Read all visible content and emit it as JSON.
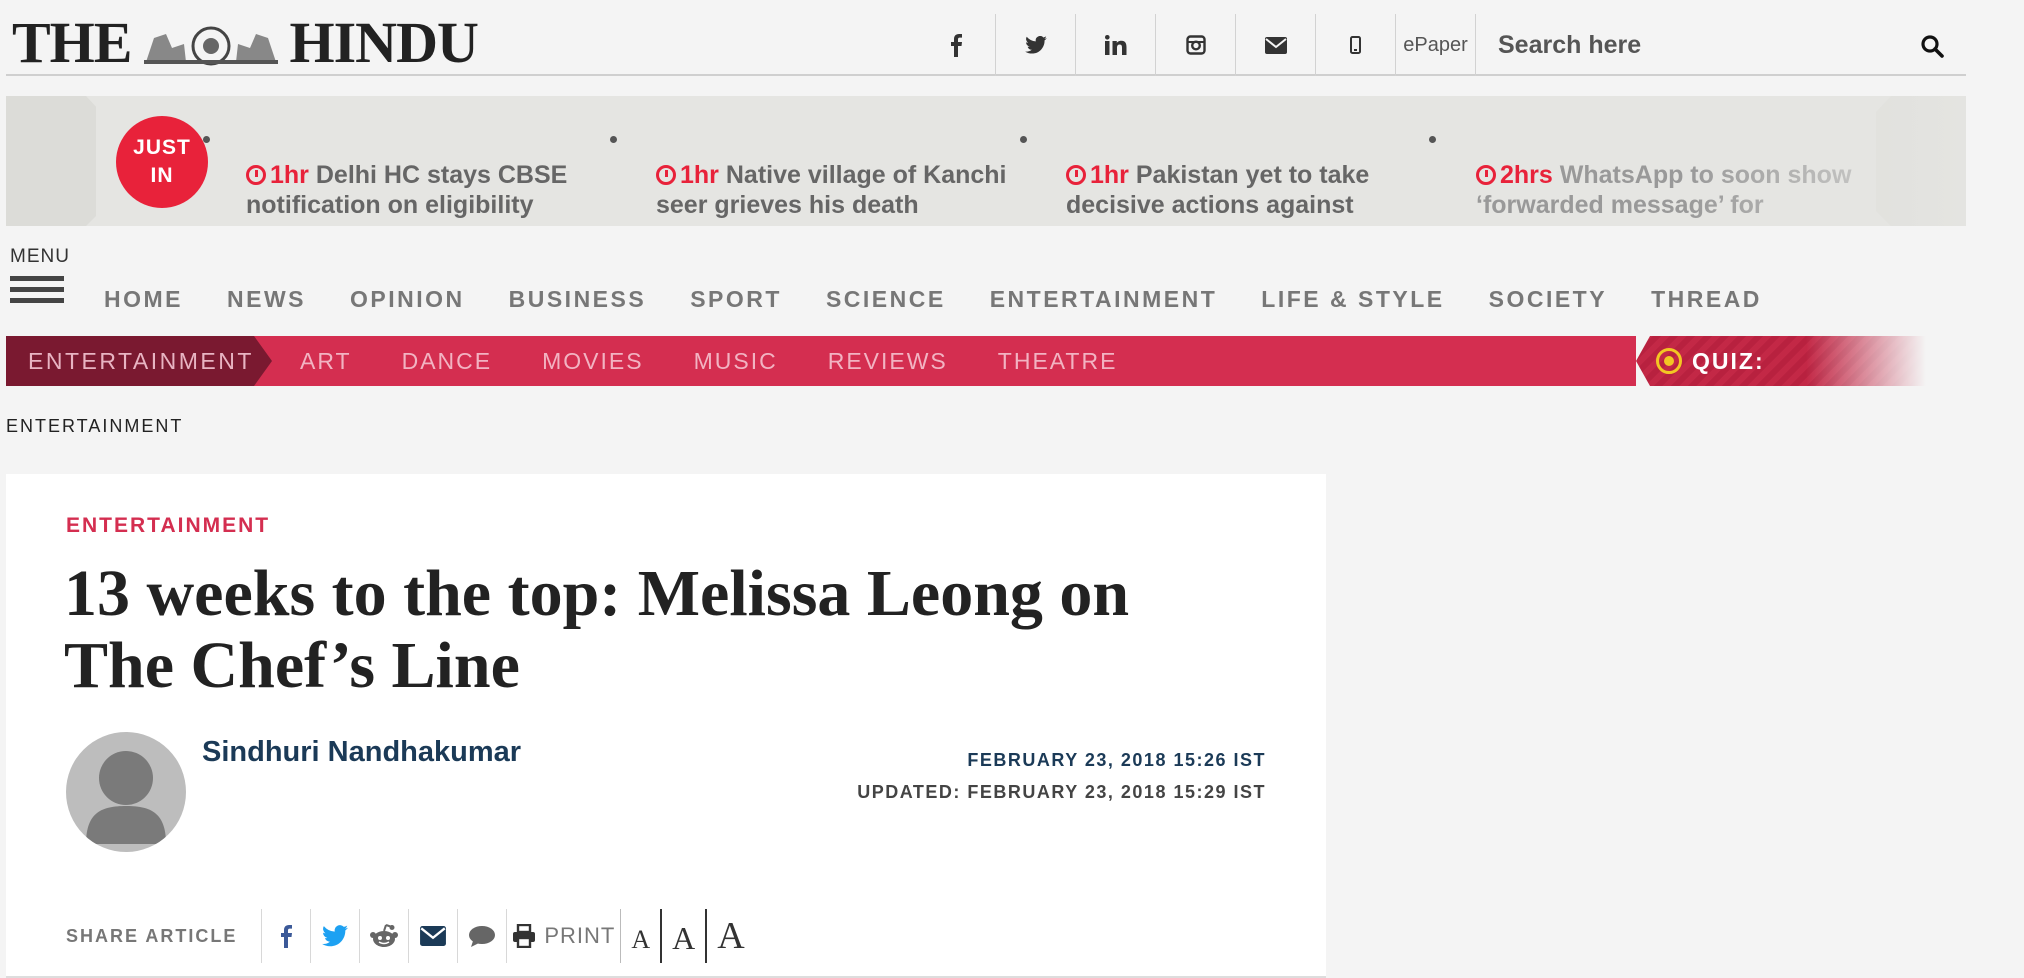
{
  "header": {
    "logo_left": "THE",
    "logo_right": "HINDU",
    "social": [
      "f",
      "twitter",
      "in",
      "instagram",
      "mail",
      "mobile"
    ],
    "epaper": "ePaper",
    "search_placeholder": "Search here"
  },
  "ticker": {
    "badge_line1": "JUST",
    "badge_line2": "IN",
    "items": [
      {
        "time": "1hr",
        "text": "Delhi HC stays CBSE notification on eligibility"
      },
      {
        "time": "1hr",
        "text": "Native village of Kanchi seer grieves his death"
      },
      {
        "time": "1hr",
        "text": "Pakistan yet to take decisive actions against"
      },
      {
        "time": "2hrs",
        "text": "WhatsApp to soon show ‘forwarded message’ for"
      }
    ]
  },
  "menu": {
    "label": "MENU",
    "items": [
      "HOME",
      "NEWS",
      "OPINION",
      "BUSINESS",
      "SPORT",
      "SCIENCE",
      "ENTERTAINMENT",
      "LIFE & STYLE",
      "SOCIETY",
      "THREAD"
    ]
  },
  "subnav": {
    "current": "ENTERTAINMENT",
    "items": [
      "ART",
      "DANCE",
      "MOVIES",
      "MUSIC",
      "REVIEWS",
      "THEATRE"
    ],
    "quiz_label": "QUIZ:"
  },
  "breadcrumb": "ENTERTAINMENT",
  "article": {
    "kicker": "ENTERTAINMENT",
    "headline_line1": "13 weeks to the top: Melissa Leong on",
    "headline_line2": "The Chef’s Line",
    "author": "Sindhuri Nandhakumar",
    "published": "FEBRUARY 23, 2018 15:26 IST",
    "updated": "UPDATED: FEBRUARY 23, 2018 15:29 IST",
    "share_label": "SHARE ARTICLE",
    "print_label": "PRINT",
    "font_sizes": [
      "A",
      "A",
      "A"
    ]
  },
  "colors": {
    "accent": "#d42e50",
    "accent_dark": "#7a1930",
    "ticker_red": "#e8223a",
    "author_blue": "#1b3a57"
  }
}
